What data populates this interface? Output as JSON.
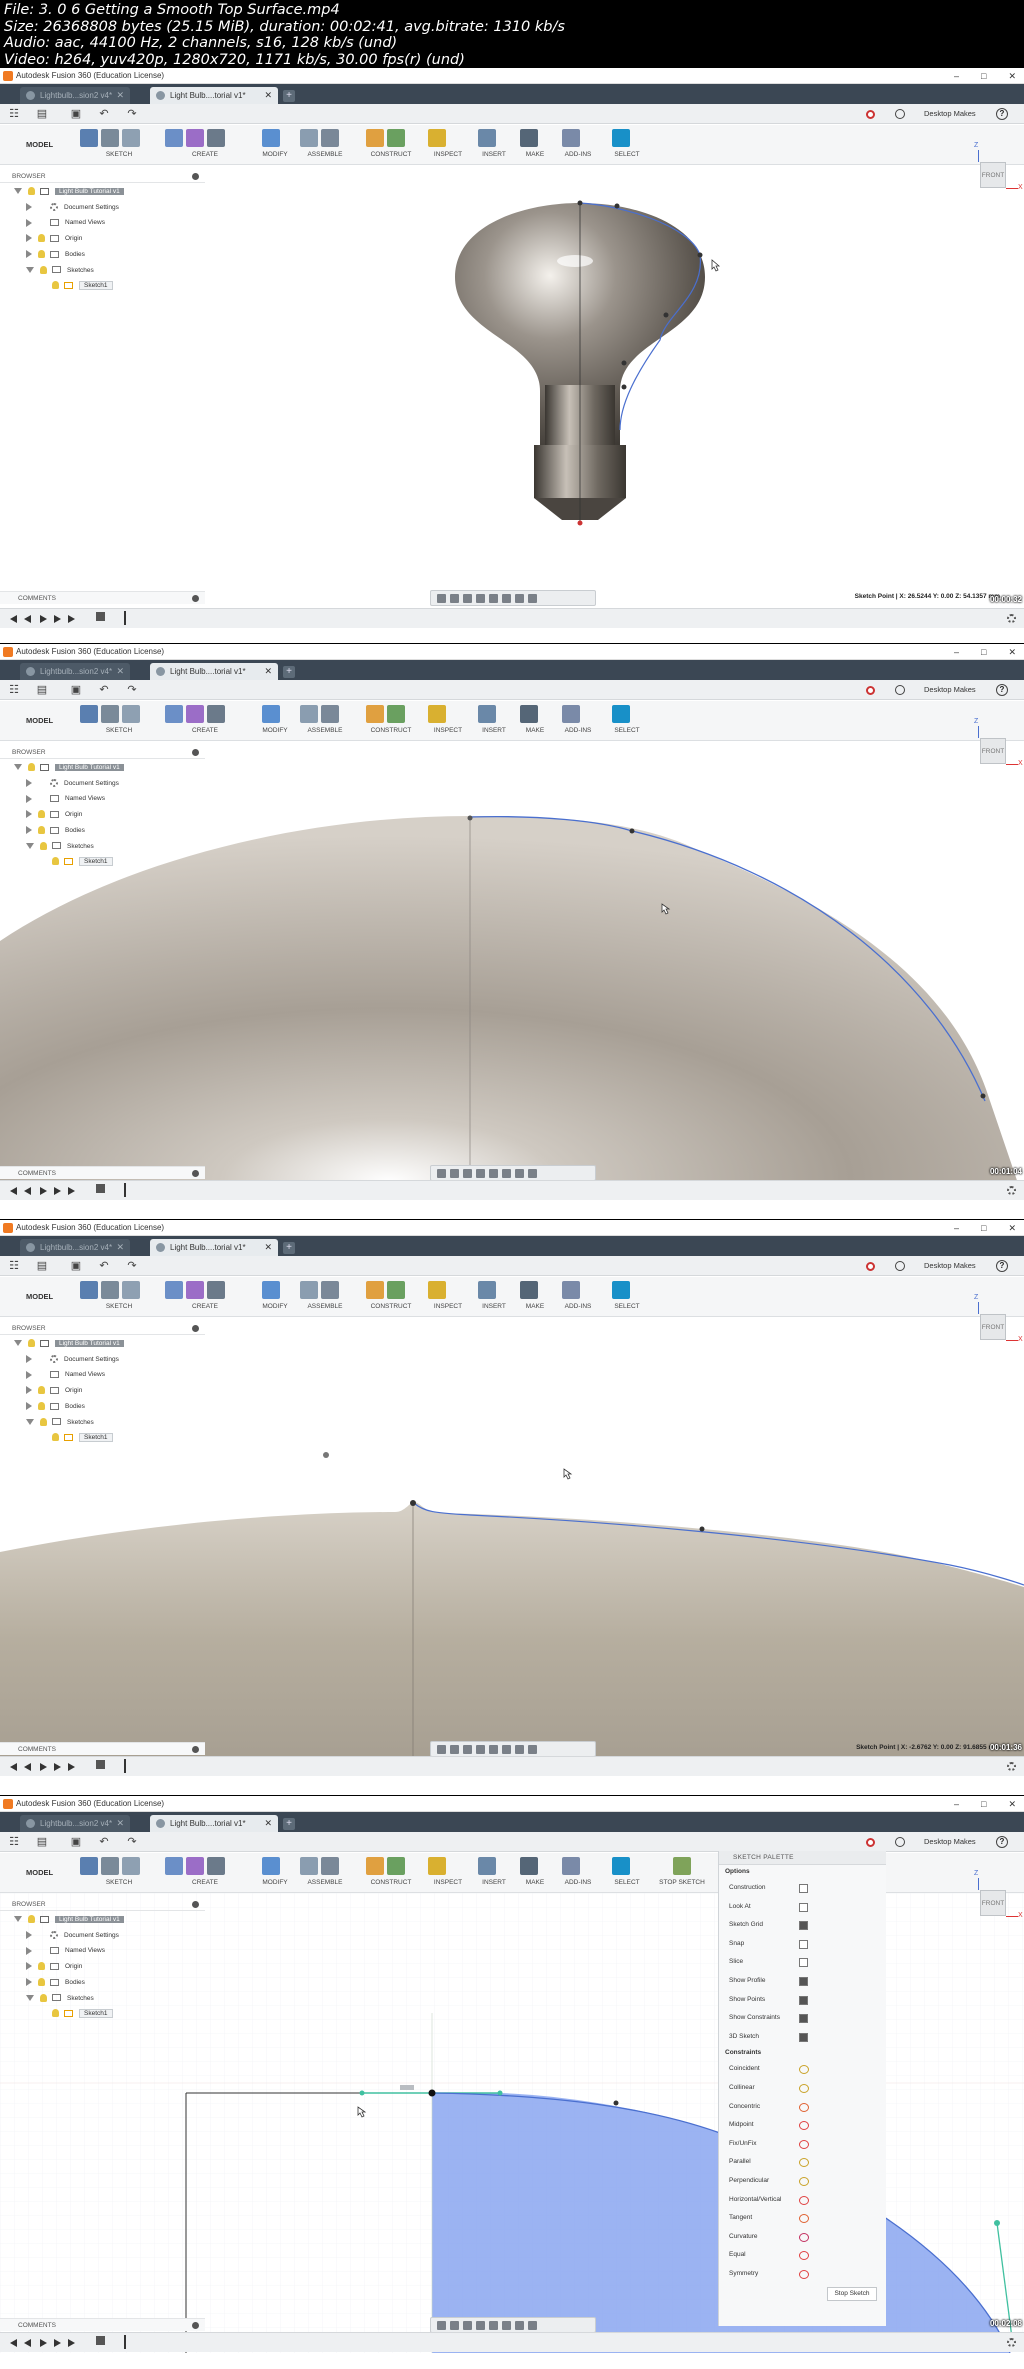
{
  "info": {
    "file": "File: 3. 0 6 Getting a Smooth Top Surface.mp4",
    "size": "Size: 26368808 bytes (25.15 MiB), duration: 00:02:41, avg.bitrate: 1310 kb/s",
    "audio": "Audio: aac, 44100 Hz, 2 channels, s16, 128 kb/s (und)",
    "video": "Video: h264, yuv420p, 1280x720, 1171 kb/s, 30.00 fps(r) (und)"
  },
  "app": {
    "window_title": "Autodesk Fusion 360 (Education License)",
    "tab_inactive": "Lightbulb...sion2 v4*",
    "tab_active": "Light Bulb....torial v1*",
    "user": "Desktop Makes",
    "workspace": "MODEL",
    "toolbar_groups": [
      "SKETCH",
      "CREATE",
      "MODIFY",
      "ASSEMBLE",
      "CONSTRUCT",
      "INSPECT",
      "INSERT",
      "MAKE",
      "ADD-INS",
      "SELECT"
    ],
    "stop_sketch_group": "STOP SKETCH",
    "browser_label": "BROWSER",
    "comments_label": "COMMENTS",
    "viewcube_label": "FRONT",
    "tree": {
      "root": "Light Bulb Tutorial v1",
      "items": [
        "Document Settings",
        "Named Views",
        "Origin",
        "Bodies",
        "Sketches"
      ],
      "sketch": "Sketch1"
    }
  },
  "frames": [
    {
      "status": "Sketch Point | X: 26.5244 Y: 0.00 Z: 54.1357 mm",
      "timestamp": "00:00:32"
    },
    {
      "status": "",
      "timestamp": "00:01:04"
    },
    {
      "status": "Sketch Point | X: -2.6762 Y: 0.00 Z: 91.6855 mm",
      "timestamp": "00:01:36"
    },
    {
      "status": "",
      "timestamp": "00:02:08"
    }
  ],
  "palette": {
    "title": "SKETCH PALETTE",
    "options_label": "Options",
    "options": [
      {
        "label": "Construction",
        "checked": false
      },
      {
        "label": "Look At",
        "checked": false
      },
      {
        "label": "Sketch Grid",
        "checked": true
      },
      {
        "label": "Snap",
        "checked": false
      },
      {
        "label": "Slice",
        "checked": false
      },
      {
        "label": "Show Profile",
        "checked": true
      },
      {
        "label": "Show Points",
        "checked": true
      },
      {
        "label": "Show Constraints",
        "checked": true
      },
      {
        "label": "3D Sketch",
        "checked": true
      }
    ],
    "constraints_label": "Constraints",
    "constraints": [
      {
        "label": "Coincident",
        "color": "#c9a227"
      },
      {
        "label": "Collinear",
        "color": "#c9a227"
      },
      {
        "label": "Concentric",
        "color": "#e06030"
      },
      {
        "label": "Midpoint",
        "color": "#e04040"
      },
      {
        "label": "Fix/UnFix",
        "color": "#e04040"
      },
      {
        "label": "Parallel",
        "color": "#c9a227"
      },
      {
        "label": "Perpendicular",
        "color": "#c9a227"
      },
      {
        "label": "Horizontal/Vertical",
        "color": "#e04040"
      },
      {
        "label": "Tangent",
        "color": "#e06030"
      },
      {
        "label": "Curvature",
        "color": "#c33060"
      },
      {
        "label": "Equal",
        "color": "#e04040"
      },
      {
        "label": "Symmetry",
        "color": "#e04040"
      }
    ],
    "stop_sketch": "Stop Sketch"
  },
  "colors": {
    "accent_select": "#1890c8",
    "tabbar": "#3b4754",
    "profile_fill": "#8aa6f0",
    "curve_blue": "#4a6fcf"
  }
}
